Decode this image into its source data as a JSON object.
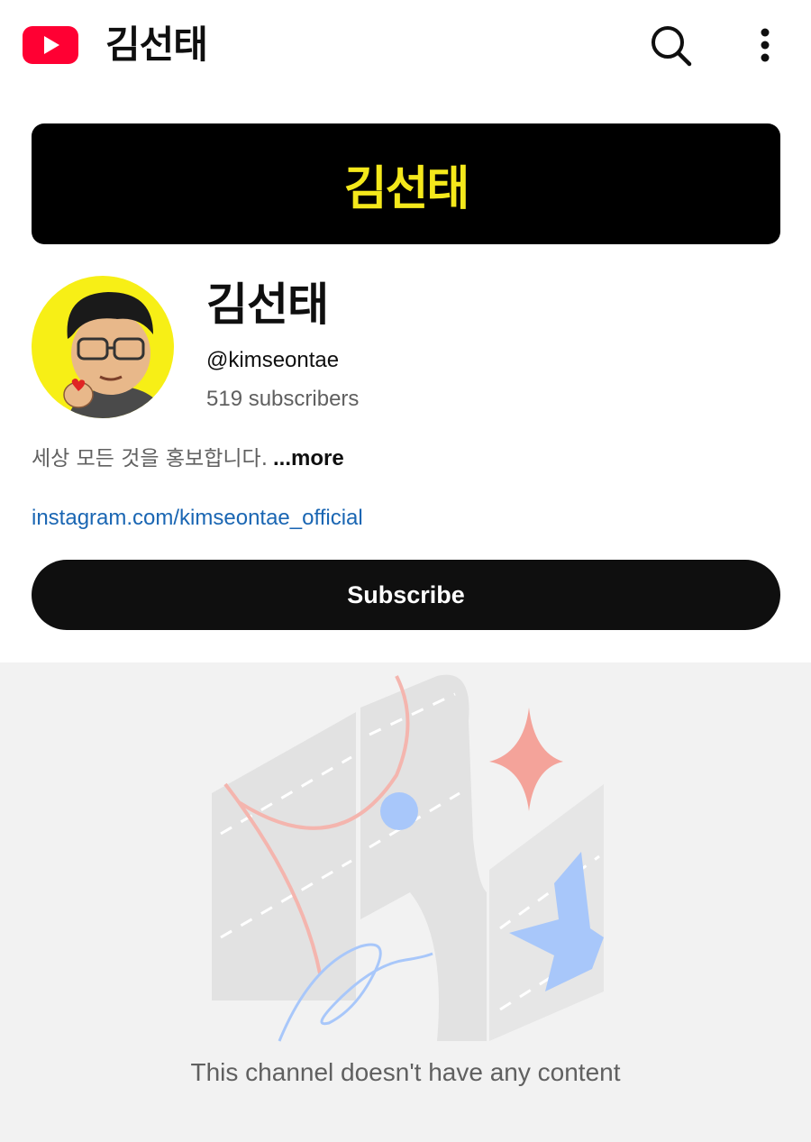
{
  "colors": {
    "brand_red": "#ff0033",
    "banner_bg": "#000000",
    "banner_text": "#f4e81b",
    "avatar_bg": "#f7ef16",
    "link": "#1a66b3",
    "subscribe_bg": "#0f0f0f",
    "empty_bg": "#f2f2f2"
  },
  "header": {
    "title": "김선태",
    "logo_icon": "youtube-logo-icon",
    "search_icon": "search-icon",
    "more_icon": "more-vertical-icon"
  },
  "banner": {
    "text": "김선태"
  },
  "channel": {
    "name": "김선태",
    "handle": "@kimseontae",
    "subscribers": "519 subscribers",
    "description": "세상 모든 것을 홍보합니다.",
    "more_label": "...more",
    "link": "instagram.com/kimseontae_official",
    "avatar_icon": "cartoon-avatar"
  },
  "actions": {
    "subscribe_label": "Subscribe"
  },
  "empty_state": {
    "message": "This channel doesn't have any content",
    "illustration_icon": "empty-channel-illustration"
  }
}
